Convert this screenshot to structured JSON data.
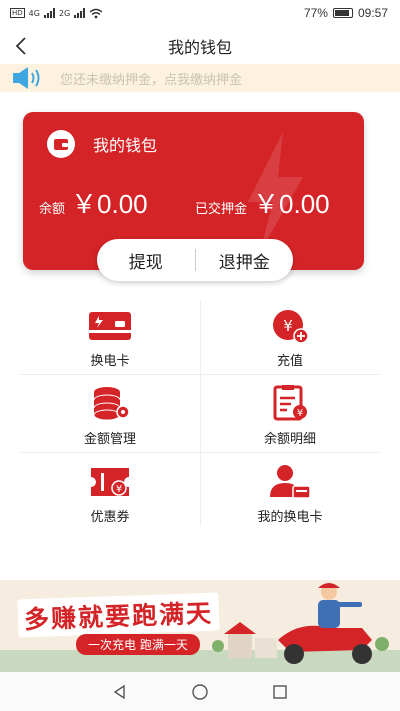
{
  "status_bar": {
    "network_left": "HD",
    "signal_a_label": "4G",
    "signal_b_label": "2G",
    "battery": "77%",
    "battery_level": 0.77,
    "time": "09:57"
  },
  "nav": {
    "back_icon": "chevron-left-icon",
    "title": "我的钱包"
  },
  "notice": {
    "icon": "speaker-icon",
    "text": "您还未缴纳押金，点我缴纳押金"
  },
  "wallet": {
    "title": "我的钱包",
    "icon": "wallet-icon",
    "balance_label": "余额",
    "balance_value": "￥0.00",
    "deposit_label": "已交押金",
    "deposit_value": "￥0.00",
    "withdraw_label": "提现",
    "refund_deposit_label": "退押金"
  },
  "menu": {
    "items": [
      {
        "label": "换电卡",
        "icon": "battery-card-icon"
      },
      {
        "label": "充值",
        "icon": "recharge-coin-icon"
      },
      {
        "label": "金额管理",
        "icon": "coin-stack-icon"
      },
      {
        "label": "余额明细",
        "icon": "balance-detail-icon"
      },
      {
        "label": "优惠券",
        "icon": "coupon-icon"
      },
      {
        "label": "我的换电卡",
        "icon": "user-card-icon"
      }
    ]
  },
  "banner": {
    "slogan": "多赚就要跑满天",
    "subtitle": "一次充电 跑满一天"
  },
  "system_nav": {
    "back_icon": "triangle-back-icon",
    "home_icon": "circle-home-icon",
    "recent_icon": "square-recent-icon"
  },
  "colors": {
    "brand_red": "#d42427",
    "notice_bg": "#fdf2dd",
    "notice_text": "#c9c3b5",
    "speaker_blue": "#3fa7e0"
  }
}
